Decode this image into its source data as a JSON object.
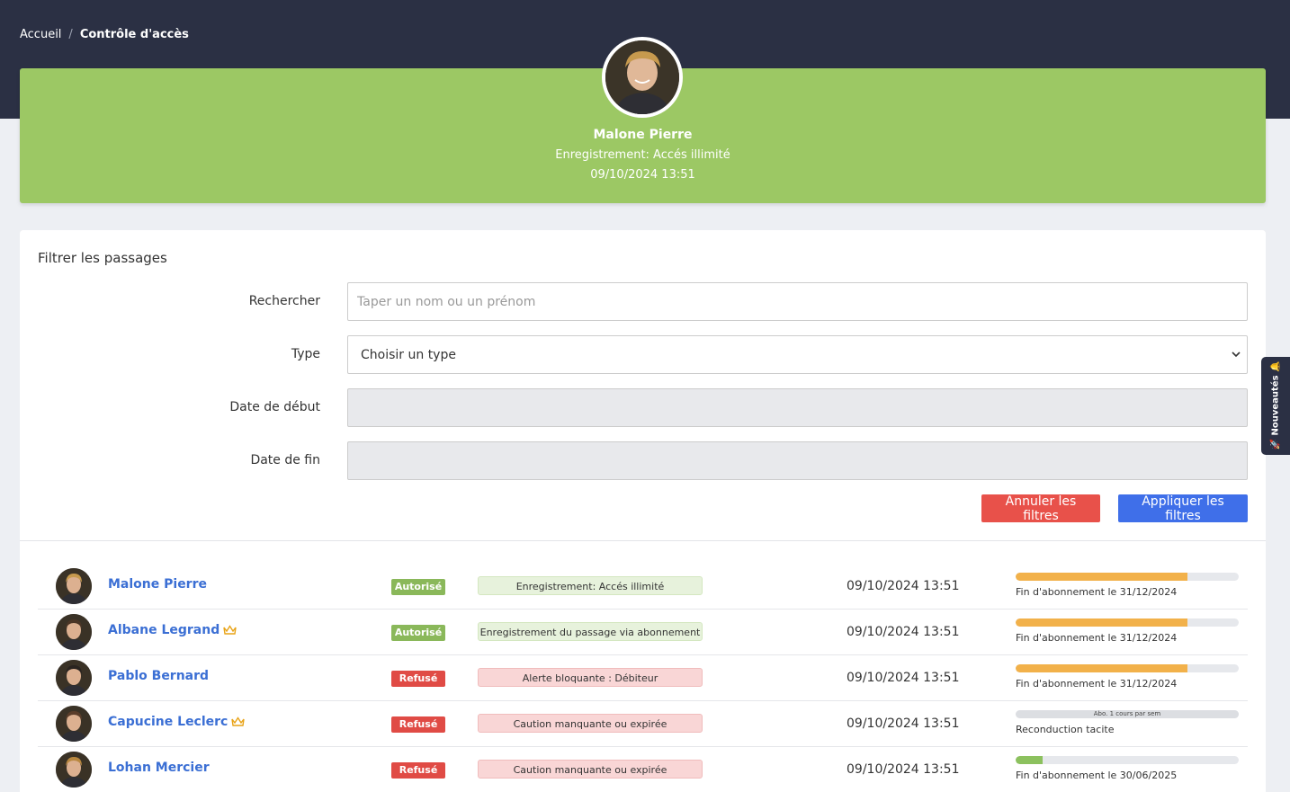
{
  "breadcrumb": {
    "home": "Accueil",
    "separator": "/",
    "current": "Contrôle d'accès"
  },
  "hero": {
    "name": "Malone Pierre",
    "status": "Enregistrement: Accés illimité",
    "datetime": "09/10/2024 13:51",
    "color": "#9cc864"
  },
  "filters": {
    "title": "Filtrer les passages",
    "search_label": "Rechercher",
    "search_placeholder": "Taper un nom ou un prénom",
    "search_value": "",
    "type_label": "Type",
    "type_value": "Choisir un type",
    "start_label": "Date de début",
    "end_label": "Date de fin",
    "cancel_label": "Annuler les filtres",
    "apply_label": "Appliquer les filtres"
  },
  "passages": [
    {
      "name": "Malone Pierre",
      "vip": false,
      "status": "Autorisé",
      "status_type": "ok",
      "message": "Enregistrement: Accés illimité",
      "datetime": "09/10/2024 13:51",
      "progress": 0.77,
      "progress_color": "#f2b14a",
      "bar_text": "",
      "sub": "Fin d'abonnement le 31/12/2024"
    },
    {
      "name": "Albane Legrand",
      "vip": true,
      "status": "Autorisé",
      "status_type": "ok",
      "message": "Enregistrement du passage via abonnement",
      "datetime": "09/10/2024 13:51",
      "progress": 0.77,
      "progress_color": "#f2b14a",
      "bar_text": "",
      "sub": "Fin d'abonnement le 31/12/2024"
    },
    {
      "name": "Pablo Bernard",
      "vip": false,
      "status": "Refusé",
      "status_type": "ko",
      "message": "Alerte bloquante : Débiteur",
      "datetime": "09/10/2024 13:51",
      "progress": 0.77,
      "progress_color": "#f2b14a",
      "bar_text": "",
      "sub": "Fin d'abonnement le 31/12/2024"
    },
    {
      "name": "Capucine Leclerc",
      "vip": true,
      "status": "Refusé",
      "status_type": "ko",
      "message": "Caution manquante ou expirée",
      "datetime": "09/10/2024 13:51",
      "progress": 1.0,
      "progress_color": "#dcdee2",
      "bar_text": "Abo. 1 cours par sem",
      "sub": "Reconduction tacite"
    },
    {
      "name": "Lohan Mercier",
      "vip": false,
      "status": "Refusé",
      "status_type": "ko",
      "message": "Caution manquante ou expirée",
      "datetime": "09/10/2024 13:51",
      "progress": 0.12,
      "progress_color": "#8cc15e",
      "bar_text": "",
      "sub": "Fin d'abonnement le 30/06/2025"
    }
  ],
  "sidetab": {
    "label": "🚀 Nouveautés 🔔"
  },
  "colors": {
    "header": "#2b3044",
    "link": "#3b6fd4",
    "danger": "#e8514a",
    "primary": "#3f6fe9",
    "crown": "#e8a317"
  }
}
